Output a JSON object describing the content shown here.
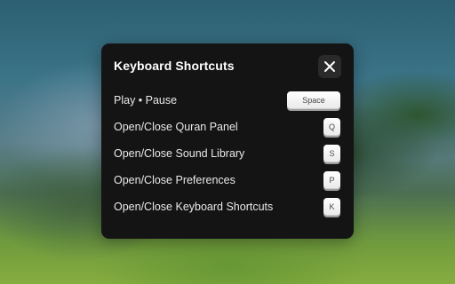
{
  "dialog": {
    "title": "Keyboard Shortcuts",
    "close_icon": "close-icon",
    "shortcuts": [
      {
        "label": "Play • Pause",
        "key": "Space"
      },
      {
        "label": "Open/Close Quran Panel",
        "key": "Q"
      },
      {
        "label": "Open/Close Sound Library",
        "key": "S"
      },
      {
        "label": "Open/Close Preferences",
        "key": "P"
      },
      {
        "label": "Open/Close Keyboard Shortcuts",
        "key": "K"
      }
    ]
  },
  "colors": {
    "panel_background": "#141414",
    "key_cap": "#f2f2f2",
    "text": "#e9e9e9"
  }
}
